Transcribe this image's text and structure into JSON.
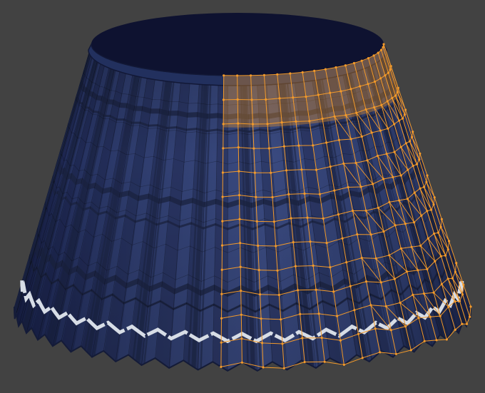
{
  "viewport": {
    "name": "3d-viewport",
    "background_color": "#424242"
  },
  "model": {
    "name": "pleated-skirt-mesh",
    "cloth_color": "#2b3a68",
    "cloth_dark": "#1a2449",
    "plaid_line_color": "#1b2340",
    "stripe_color": "#d7dde6",
    "inner_color": "#0e1230",
    "pleat_count": 24,
    "selection_color": "#f39a2b"
  }
}
